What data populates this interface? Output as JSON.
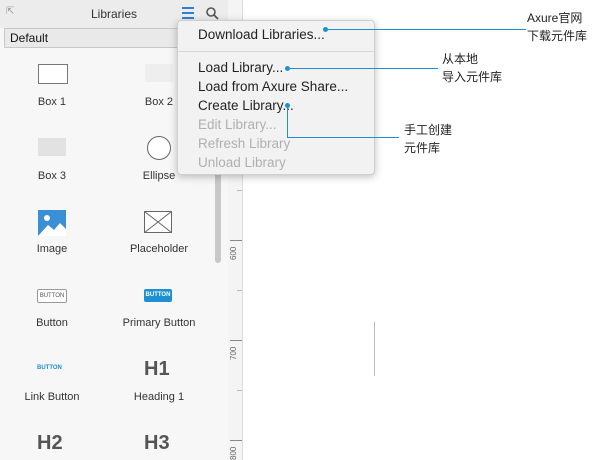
{
  "panel": {
    "title": "Libraries",
    "selected_library": "Default",
    "widgets": [
      {
        "label": "Box 1"
      },
      {
        "label": "Box 2"
      },
      {
        "label": "Box 3"
      },
      {
        "label": "Ellipse"
      },
      {
        "label": "Image"
      },
      {
        "label": "Placeholder"
      },
      {
        "label": "Button"
      },
      {
        "label": "Primary Button"
      },
      {
        "label": "Link Button"
      },
      {
        "label": "Heading 1"
      },
      {
        "label": "H2"
      },
      {
        "label": "H3"
      }
    ],
    "widget_thumb_text": {
      "button": "BUTTON",
      "primary_button": "BUTTON",
      "link_button": "BUTTON",
      "h1": "H1"
    }
  },
  "ruler": {
    "labels": [
      "600",
      "700",
      "800"
    ]
  },
  "dropdown": {
    "items": [
      {
        "label": "Download Libraries...",
        "enabled": true
      },
      {
        "label": "Load Library...",
        "enabled": true
      },
      {
        "label": "Load from Axure Share...",
        "enabled": true
      },
      {
        "label": "Create Library...",
        "enabled": true
      },
      {
        "label": "Edit Library...",
        "enabled": false
      },
      {
        "label": "Refresh Library",
        "enabled": false
      },
      {
        "label": "Unload Library",
        "enabled": false
      }
    ]
  },
  "annotations": [
    {
      "lines": [
        "Axure官网",
        "下载元件库"
      ]
    },
    {
      "lines": [
        "从本地",
        "导入元件库"
      ]
    },
    {
      "lines": [
        "手工创建",
        "元件库"
      ]
    }
  ],
  "colors": {
    "accent": "#1e8fd1",
    "menu_icon": "#2f7fd6",
    "disabled_text": "#b0b0b0"
  }
}
